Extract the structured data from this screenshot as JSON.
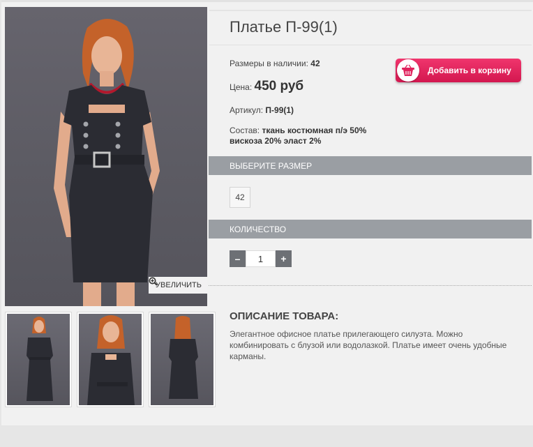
{
  "product": {
    "title": "Платье П-99(1)",
    "sizes_label": "Размеры в наличии:",
    "sizes_value": "42",
    "price_label": "Цена:",
    "price_value": "450 руб",
    "article_label": "Артикул:",
    "article_value": "П-99(1)",
    "composition_label": "Состав:",
    "composition_line1": "ткань костюмная п/э 50%",
    "composition_line2": "вискоза 20% эласт 2%"
  },
  "buttons": {
    "add_to_cart": "Добавить в корзину",
    "zoom": "УВЕЛИЧИТЬ"
  },
  "size_section": {
    "title": "ВЫБЕРИТЕ РАЗМЕР",
    "options": [
      "42"
    ]
  },
  "quantity_section": {
    "title": "КОЛИЧЕСТВО",
    "minus": "–",
    "plus": "+",
    "value": "1"
  },
  "description": {
    "title": "ОПИСАНИЕ ТОВАРА:",
    "text": "Элегантное офисное платье прилегающего силуэта. Можно комбинировать с блузой или водолазкой. Платье имеет очень удобные карманы."
  },
  "icons": {
    "zoom": "magnifier-plus-icon",
    "cart": "basket-icon"
  },
  "colors": {
    "accent": "#e0245e",
    "section_bar": "#9a9ea3",
    "stepper": "#6d7075"
  }
}
